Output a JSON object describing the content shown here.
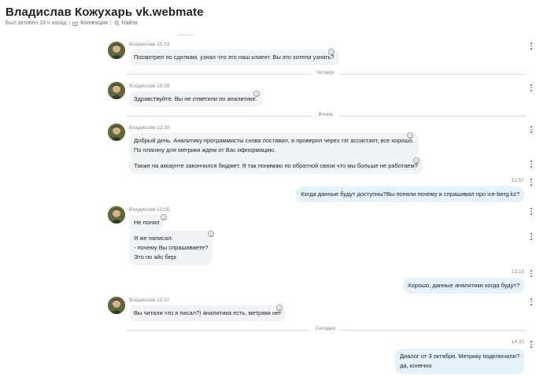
{
  "header": {
    "title": "Владислав Кожухарь vk.webmate",
    "status": "Был активен 19 ч назад",
    "collection_label": "Коллекция",
    "find_label": "Найти"
  },
  "messages": [
    {
      "author": "Владислав",
      "time": "15:33",
      "lines": [
        "Посмотрел по сделкам, узнал что это наш клиент. Вы это хотели узнать?"
      ]
    },
    {
      "divider": "Четверг"
    },
    {
      "author": "Владислав",
      "time": "19:39",
      "lines": [
        "Здравствуйте. Вы не ответили по аналитике."
      ]
    },
    {
      "divider": "Вчера"
    },
    {
      "author": "Владислав",
      "time": "12:30",
      "lines": [
        "Добрый день. Аналитику программисты снова поставил, я проверил через тэг ассистант, все хорошо.",
        "По плагину для метрики ждем от Вас ифнормацию."
      ]
    },
    {
      "author": "Владислав",
      "lines": [
        "Также на аккаунте закончился бюджет. Я так понимаю по обратной связи что мы больше не работаем?"
      ]
    },
    {
      "out": true,
      "time": "12:57",
      "lines": [
        "Когда данные будут доступны?Вы поняли почему я спрашивал про ice-berg.kz?"
      ]
    },
    {
      "author": "Владислав",
      "time": "13:05",
      "lines": [
        "Не понял"
      ]
    },
    {
      "author": "Владислав",
      "lines": [
        "Я же написал:",
        "- почему Вы спрашиваете?",
        "Это по айс берг"
      ]
    },
    {
      "out": true,
      "time": "13:21",
      "lines": [
        "Хорошо, данные аналитики когда будут?"
      ]
    },
    {
      "author": "Владислав",
      "time": "13:37",
      "lines": [
        "Вы читали что я писал?) аналитика есть, метрики нет"
      ]
    },
    {
      "divider": "Сегодня"
    },
    {
      "out": true,
      "time": "14:31",
      "lines": [
        "Диалог от 3 октября. Метрику подключили?",
        "да, конечно"
      ]
    }
  ],
  "colors": {
    "incoming": "#f1f3f6",
    "outgoing": "#e3f2fb",
    "divider": "#dddddd"
  },
  "icons": {
    "collection": "book-icon",
    "find": "search-icon",
    "reaction": "smile-icon",
    "menu": "more-vertical-icon"
  }
}
